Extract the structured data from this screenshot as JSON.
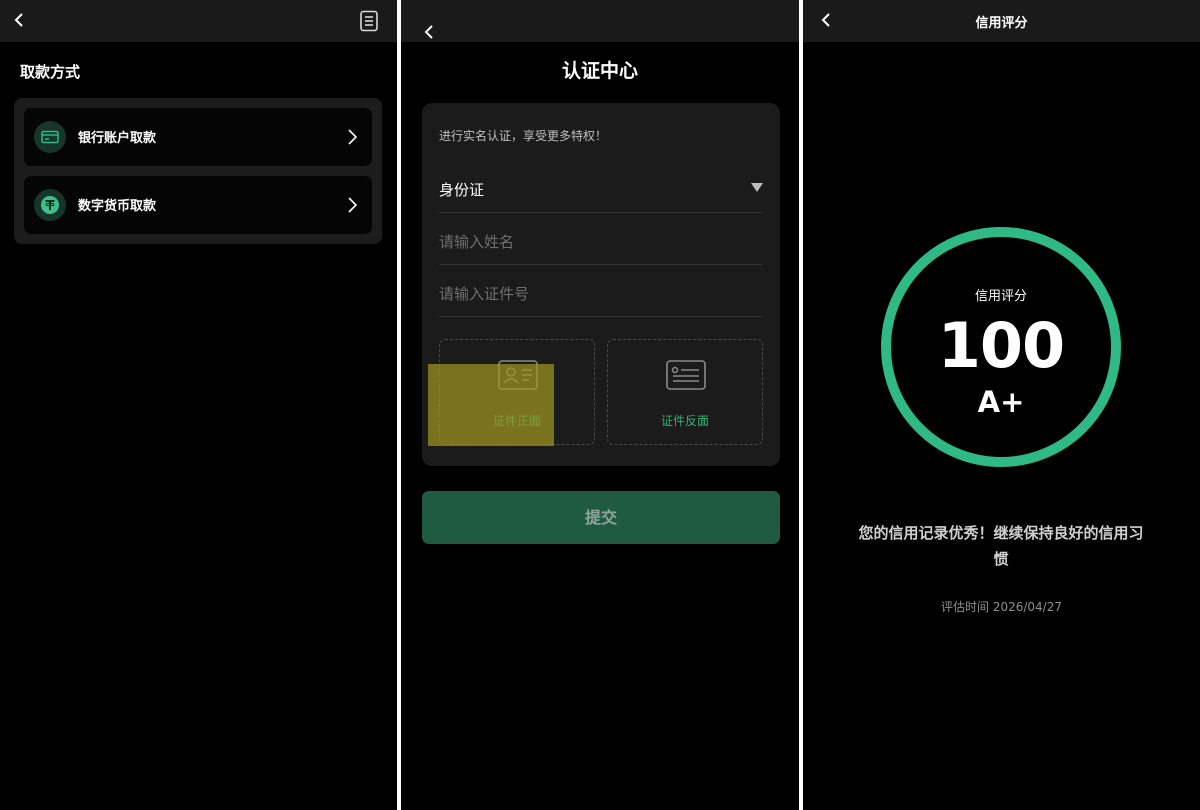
{
  "screen_withdraw": {
    "section_title": "取款方式",
    "methods": [
      {
        "label": "银行账户取款",
        "icon": "bank-card-icon"
      },
      {
        "label": "数字货币取款",
        "icon": "tether-coin-icon"
      }
    ]
  },
  "screen_verify": {
    "title": "认证中心",
    "hint": "进行实名认证，享受更多特权！",
    "id_type": {
      "value": "身份证"
    },
    "name_field": {
      "placeholder": "请输入姓名"
    },
    "id_field": {
      "placeholder": "请输入证件号"
    },
    "uploads": [
      {
        "label": "证件正面",
        "icon": "id-card-front-icon"
      },
      {
        "label": "证件反面",
        "icon": "id-card-back-icon"
      }
    ],
    "submit_label": "提交"
  },
  "screen_credit": {
    "title": "信用评分",
    "ring_label": "信用评分",
    "score": "100",
    "grade": "A+",
    "message": "您的信用记录优秀！继续保持良好的信用习惯",
    "eval_time": "评估时间 2026/04/27"
  },
  "colors": {
    "accent_green": "#2fb985",
    "submit_bg": "#1f5b40",
    "background": "#000000",
    "card_bg": "#1b1b1b"
  }
}
